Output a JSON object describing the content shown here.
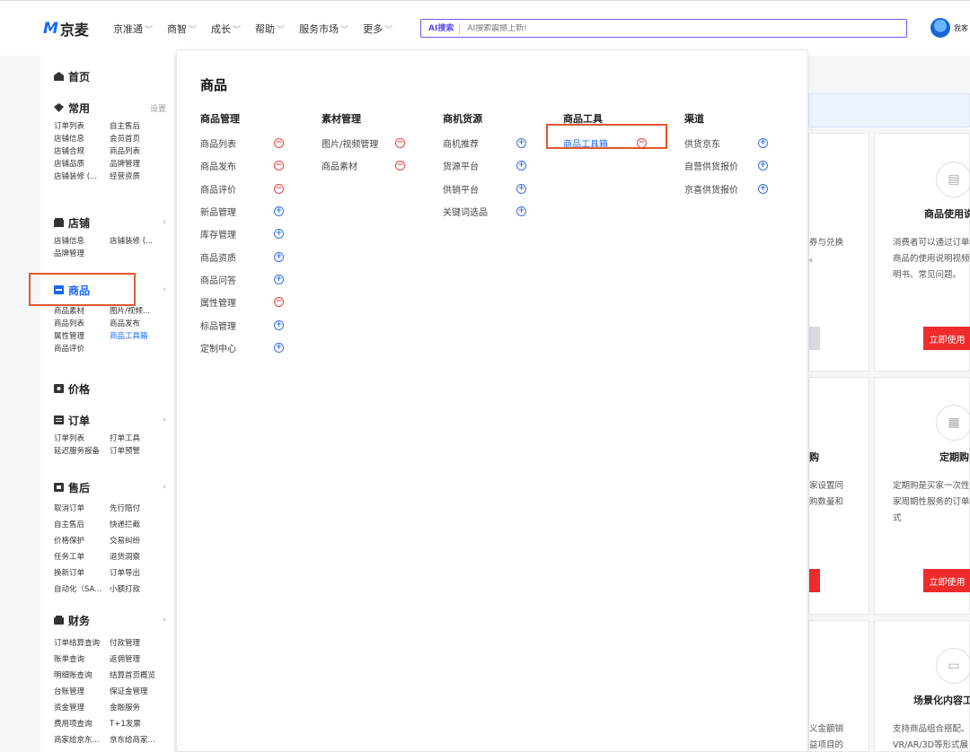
{
  "header": {
    "logo_mark": "M",
    "logo_text": "京麦",
    "nav": [
      {
        "label": "京准通"
      },
      {
        "label": "商智"
      },
      {
        "label": "成长"
      },
      {
        "label": "帮助"
      },
      {
        "label": "服务市场"
      },
      {
        "label": "更多"
      }
    ],
    "ai_badge": "AI搜索",
    "search_placeholder": "AI搜索震撼上新!",
    "user_name": "我客"
  },
  "sidebar": {
    "home": "首页",
    "common": {
      "title": "常用",
      "action": "设置",
      "links": [
        "订单列表",
        "自主售后",
        "店铺信息",
        "会员首页",
        "店铺合规",
        "商品列表",
        "店铺品质",
        "品牌管理",
        "店铺装修 (...",
        "经营资质"
      ]
    },
    "store": {
      "title": "店铺",
      "links": [
        "店铺信息",
        "店铺装修 (...",
        "品牌管理"
      ]
    },
    "goods": {
      "title": "商品",
      "links": [
        "商品素材",
        "图片/视频...",
        "商品列表",
        "商品发布",
        "属性管理",
        "商品工具箱",
        "商品评价"
      ]
    },
    "price": {
      "title": "价格"
    },
    "order": {
      "title": "订单",
      "links": [
        "订单列表",
        "打单工具",
        "延迟服务报备",
        "订单预警"
      ]
    },
    "aftersale": {
      "title": "售后",
      "links": [
        "取消订单",
        "先行赔付",
        "自主售后",
        "快递拦截",
        "价格保护",
        "交易纠纷",
        "任务工单",
        "退货洞察",
        "换新订单",
        "订单导出",
        "自动化（SA...",
        "小额打款"
      ]
    },
    "finance": {
      "title": "财务",
      "links": [
        "订单结算查询",
        "付款管理",
        "账单查询",
        "返佣管理",
        "明细账查询",
        "结算首页概览",
        "台账管理",
        "保证金管理",
        "资金管理",
        "金融服务",
        "费用项查询",
        "T+1发票",
        "商家给京东...",
        "京东给商家..."
      ]
    }
  },
  "panel": {
    "title": "商品",
    "columns": [
      {
        "head": "商品管理",
        "items": [
          {
            "label": "商品列表",
            "mark": "remove"
          },
          {
            "label": "商品发布",
            "mark": "remove"
          },
          {
            "label": "商品评价",
            "mark": "remove"
          },
          {
            "label": "新品管理",
            "mark": "add"
          },
          {
            "label": "库存管理",
            "mark": "add"
          },
          {
            "label": "商品资质",
            "mark": "add"
          },
          {
            "label": "商品问答",
            "mark": "add"
          },
          {
            "label": "属性管理",
            "mark": "remove"
          },
          {
            "label": "标品管理",
            "mark": "add"
          },
          {
            "label": "定制中心",
            "mark": "add"
          }
        ]
      },
      {
        "head": "素材管理",
        "items": [
          {
            "label": "图片/视频管理",
            "mark": "remove"
          },
          {
            "label": "商品素材",
            "mark": "remove"
          }
        ]
      },
      {
        "head": "商机货源",
        "items": [
          {
            "label": "商机推荐",
            "mark": "add"
          },
          {
            "label": "货源平台",
            "mark": "add"
          },
          {
            "label": "供销平台",
            "mark": "add"
          },
          {
            "label": "关键词选品",
            "mark": "add"
          }
        ]
      },
      {
        "head": "商品工具",
        "items": [
          {
            "label": "商品工具箱",
            "mark": "remove",
            "active": true
          }
        ]
      },
      {
        "head": "渠道",
        "items": [
          {
            "label": "供货京东",
            "mark": "add"
          },
          {
            "label": "自营供货报价",
            "mark": "add"
          },
          {
            "label": "京喜供货报价",
            "mark": "add"
          }
        ]
      }
    ]
  },
  "background": {
    "card1": {
      "desc": [
        "券与兑换",
        "。"
      ]
    },
    "card2": {
      "title": "商品使用说",
      "desc": [
        "消费者可以通过订单",
        "商品的使用说明视频",
        "明书、常见问题。"
      ],
      "button": "立即使用"
    },
    "card3": {
      "title": "购",
      "desc": [
        "家设置同",
        "购数量和"
      ]
    },
    "card4": {
      "title": "定期购",
      "desc": [
        "定期购是买家一次性",
        "家周期性服务的订单",
        "式"
      ],
      "button": "立即使用"
    },
    "card5": {
      "desc": [
        "义金额销",
        "益项目的"
      ]
    },
    "card6": {
      "title": "场景化内容工",
      "desc": [
        "支持商品组合搭配、",
        "VR/AR/3D等形式展"
      ]
    }
  },
  "colors": {
    "brand": "#1868ff",
    "danger": "#e5453d",
    "highlight": "#e4572e",
    "button_red": "#f02b2b"
  }
}
